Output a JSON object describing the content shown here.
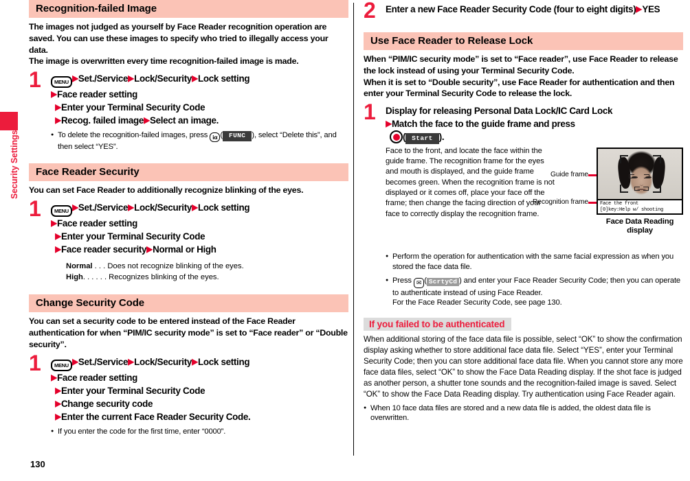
{
  "sidebar": {
    "chapter_label": "Security Settings",
    "tab_color": "#ec1c3c"
  },
  "page_number": "130",
  "colors": {
    "section_heading_bg": "#fbc3b6",
    "accent_red": "#ec1c3c",
    "arrow_red": "#e4002b",
    "subheading_bg": "#dcdcdc"
  },
  "left_column": {
    "sections": [
      {
        "heading": "Recognition-failed Image",
        "intro": "The images not judged as yourself by Face Reader recognition operation are saved. You can use these images to specify who tried to illegally access your data.\nThe image is overwritten every time recognition-failed image is made.",
        "step_number": "1",
        "step_lines": [
          "Set./Service",
          "Lock/Security",
          "Lock setting",
          "Face reader setting",
          "Enter your Terminal Security Code",
          "Recog. failed image",
          "Select an image."
        ],
        "note": "To delete the recognition-failed images, press",
        "note_tail": "), select “Delete this”, and then select “YES”.",
        "note_key": "iα",
        "note_softkey": "FUNC"
      },
      {
        "heading": "Face Reader Security",
        "intro": "You can set Face Reader to additionally recognize blinking of the eyes.",
        "step_number": "1",
        "step_lines": [
          "Set./Service",
          "Lock/Security",
          "Lock setting",
          "Face reader setting",
          "Enter your Terminal Security Code",
          "Face reader security",
          "Normal or High"
        ],
        "definitions": [
          {
            "term": "Normal",
            "dots": ". . .",
            "desc": "Does not recognize blinking of the eyes."
          },
          {
            "term": "High",
            "dots": ". . . . . .",
            "desc": "Recognizes blinking of the eyes."
          }
        ]
      },
      {
        "heading": "Change Security Code",
        "intro": "You can set a security code to be entered instead of the Face Reader authentication for when “PIM/IC security mode” is set to “Face reader” or “Double security”.",
        "step_number": "1",
        "step_lines": [
          "Set./Service",
          "Lock/Security",
          "Lock setting",
          "Face reader setting",
          "Enter your Terminal Security Code",
          "Change security code",
          "Enter the current Face Reader Security Code."
        ],
        "note": "If you enter the code for the first time, enter “0000”."
      }
    ]
  },
  "right_column": {
    "step2": {
      "step_number": "2",
      "line1": "Enter a new Face Reader Security Code (four to eight digits)",
      "line2": "YES"
    },
    "section": {
      "heading": "Use Face Reader to Release Lock",
      "intro": "When “PIM/IC security mode” is set to “Face reader”, use Face Reader to release the lock instead of using your Terminal Security Code.\nWhen it is set to “Double security”, use Face Reader for authentication and then enter your Terminal Security Code to release the lock.",
      "step_number": "1",
      "step_line1": "Display for releasing Personal Data Lock/IC Card Lock",
      "step_line2": "Match the face to the guide frame and press",
      "step_line3_softkey": "Start",
      "step_line3_tail": ").",
      "figure_text": "Face to the front, and locate the face within the guide frame. The recognition frame for the eyes and mouth is displayed, and the guide frame becomes green. When the recognition frame is not displayed or it comes off, place your face off the frame; then change the facing direction of your face to correctly display the recognition frame.",
      "callout_guide": "Guide frame",
      "callout_recognition": "Recognition frame",
      "phone_status_line1": "Face the front",
      "phone_status_line2": "[0]key:Help w/ shooting",
      "figure_caption": "Face Data Reading display",
      "notes": [
        "Perform the operation for authentication with the same facial expression as when you stored the face data file.",
        "Press"
      ],
      "note2_key": "✉",
      "note2_softkey": "ScrtyCd",
      "note2_tail": ") and enter your Face Reader Security Code; then you can operate to authenticate instead of using Face Reader.",
      "note2_line3": "For the Face Reader Security Code, see page 130."
    },
    "subsection": {
      "heading": "If you failed to be authenticated",
      "body": "When additional storing of the face data file is possible, select “OK” to show the confirmation display asking whether to store additional face data file. Select “YES”, enter your Terminal Security Code; then you can store additional face data file. When you cannot store any more face data files, select “OK” to show the Face Data Reading display. If the shot face is judged as another person, a shutter tone sounds and the recognition-failed image is saved. Select “OK” to show the Face Data Reading display. Try authentication using Face Reader again.",
      "note": "When 10 face data files are stored and a new data file is added, the oldest data file is overwritten."
    }
  }
}
